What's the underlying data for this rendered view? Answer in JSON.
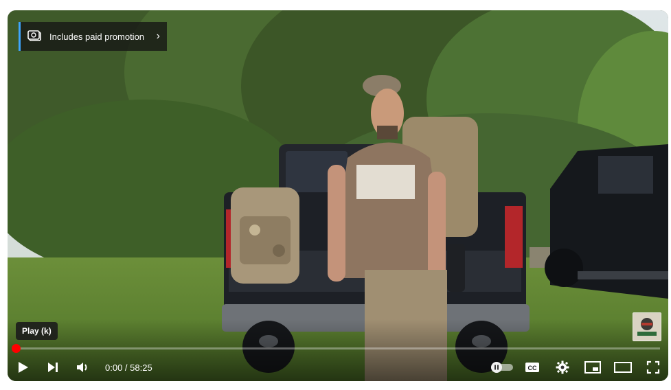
{
  "promotion": {
    "label": "Includes paid promotion",
    "icon": "paid-promotion-icon"
  },
  "tooltip": {
    "text": "Play (k)"
  },
  "player": {
    "progress_fraction": 0.0,
    "time_current": "0:00",
    "time_separator": " / ",
    "time_total": "58:25",
    "colors": {
      "progress": "#ff0000",
      "accent": "#3ea6ff"
    }
  },
  "controls": {
    "left": [
      "play-icon",
      "next-icon",
      "volume-icon"
    ],
    "right": [
      "autoplay-toggle-icon",
      "captions-icon",
      "settings-gear-icon",
      "miniplayer-icon",
      "theater-mode-icon",
      "fullscreen-icon"
    ]
  }
}
